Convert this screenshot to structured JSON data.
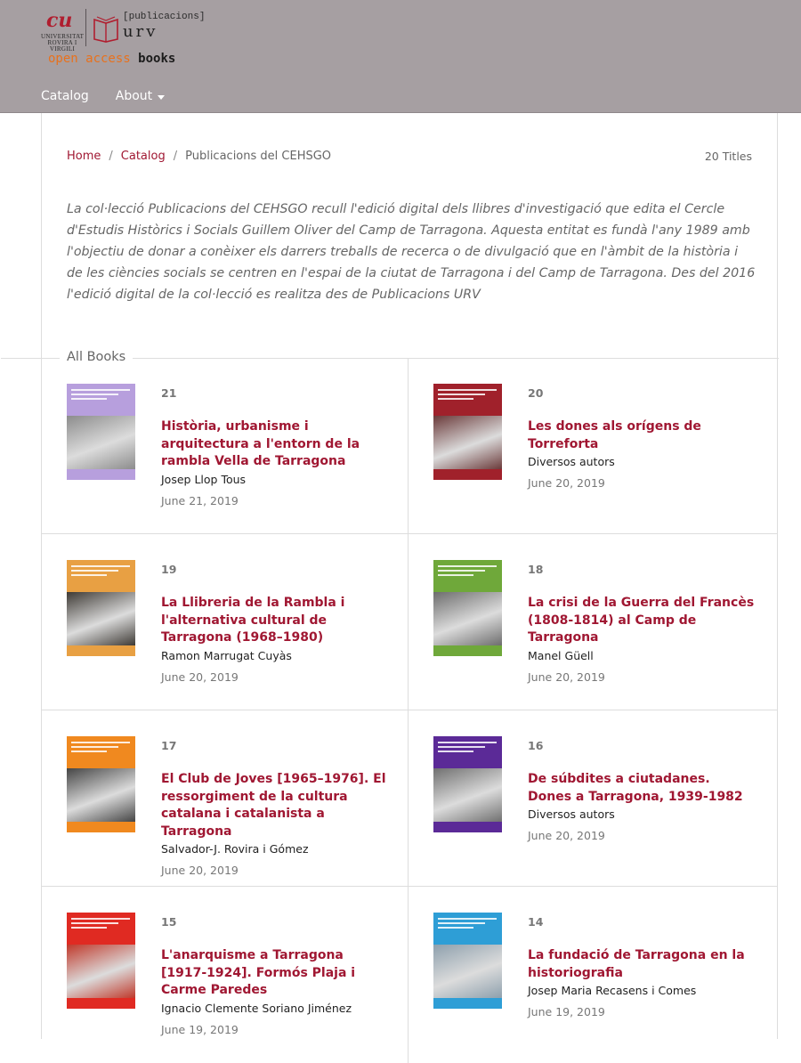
{
  "brand": {
    "urv_mark": "UNIVERSITAT ROVIRA I VIRGILI",
    "publicacions": "[publicacions]",
    "urv": "urv",
    "open_access": "open access",
    "books": "books"
  },
  "nav": [
    {
      "label": "Catalog"
    },
    {
      "label": "About"
    }
  ],
  "breadcrumb": {
    "home": "Home",
    "catalog": "Catalog",
    "current": "Publicacions del CEHSGO",
    "sep": "/"
  },
  "title_count": "20 Titles",
  "description": "La col·lecció Publicacions del CEHSGO recull l'edició digital dels llibres d'investigació que edita el Cercle d'Estudis Històrics i Socials Guillem Oliver del Camp de Tarragona. Aquesta entitat es fundà l'any 1989 amb l'objectiu de donar a conèixer els darrers treballs de recerca o de divulgació que en l'àmbit de la història i de les ciències socials se centren en l'espai de la ciutat de Tarragona i del Camp de Tarragona. Des del 2016 l'edició digital de la col·lecció es realitza des de Publicacions URV",
  "section_title": "All Books",
  "books": [
    {
      "seq": "21",
      "title": "Història, urbanisme i arquitectura a l'entorn de la rambla Vella de Tarragona",
      "authors": "Josep Llop Tous",
      "date": "June 21, 2019",
      "cover_color": "#b79fdd",
      "photo_color": "#8c8c8c"
    },
    {
      "seq": "20",
      "title": "Les dones als orígens de Torreforta",
      "authors": "Diversos autors",
      "date": "June 20, 2019",
      "cover_color": "#a0212b",
      "photo_color": "#6b3a3a"
    },
    {
      "seq": "19",
      "title": "La Llibreria de la Rambla i l'alternativa cultural de Tarragona (1968–1980)",
      "authors": "Ramon Marrugat Cuyàs",
      "date": "June 20, 2019",
      "cover_color": "#e8a043",
      "photo_color": "#3e3a35"
    },
    {
      "seq": "18",
      "title": "La crisi de la Guerra del Francès (1808-1814) al Camp de Tarragona",
      "authors": "Manel Güell",
      "date": "June 20, 2019",
      "cover_color": "#6fa83a",
      "photo_color": "#6d6d6d"
    },
    {
      "seq": "17",
      "title": "El Club de Joves [1965–1976]. El ressorgiment de la cultura catalana i catalanista a Tarragona",
      "authors": "Salvador-J. Rovira i Gómez",
      "date": "June 20, 2019",
      "cover_color": "#f0891f",
      "photo_color": "#454545"
    },
    {
      "seq": "16",
      "title": "De súbdites a ciutadanes. Dones a Tarragona, 1939-1982",
      "authors": "Diversos autors",
      "date": "June 20, 2019",
      "cover_color": "#5b2a97",
      "photo_color": "#707070"
    },
    {
      "seq": "15",
      "title": "L'anarquisme a Tarragona [1917-1924]. Formós Plaja i Carme Paredes",
      "authors": "Ignacio Clemente Soriano Jiménez",
      "date": "June 19, 2019",
      "cover_color": "#e02a22",
      "photo_color": "#c0392b"
    },
    {
      "seq": "14",
      "title": "La fundació de Tarragona en la historiografia",
      "authors": "Josep Maria Recasens i Comes",
      "date": "June 19, 2019",
      "cover_color": "#2e9ed6",
      "photo_color": "#8ea0ad"
    }
  ]
}
